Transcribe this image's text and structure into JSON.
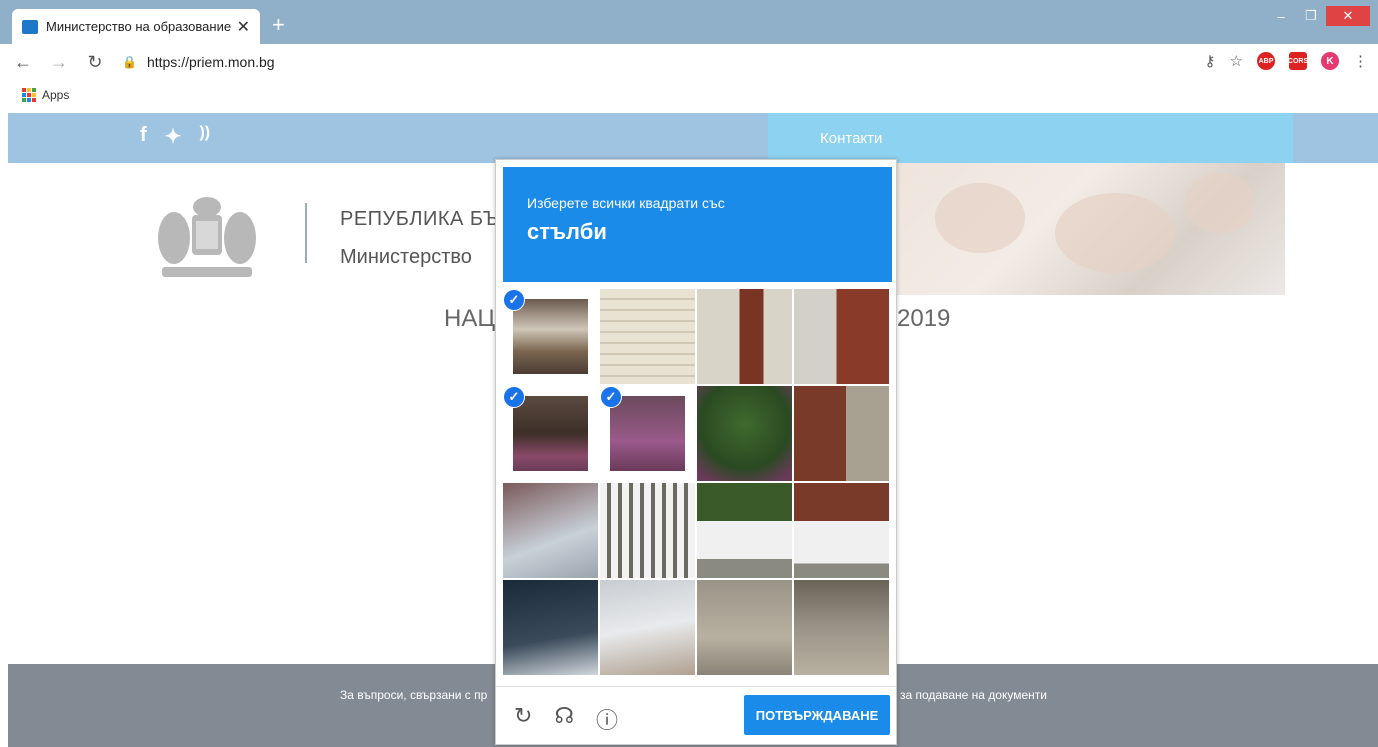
{
  "browser": {
    "tab_title": "Министерство на образованиет",
    "url": "https://priem.mon.bg",
    "bookmark_apps": "Apps",
    "extensions": {
      "abp": "ABP",
      "cors": "CORS",
      "profile": "K"
    }
  },
  "site": {
    "nav_contacts": "Контакти",
    "social": [
      "f",
      "🐦",
      "RSS"
    ],
    "republic_title": "РЕПУБЛИКА БЪ",
    "ministry_title": "Министерство",
    "national_left": "НАЦ",
    "national_right": "2019",
    "footer_left": "За въпроси, свързани с пр",
    "footer_right": "за подаване на документи"
  },
  "captcha": {
    "instruction": "Изберете всички квадрати със",
    "target_word": "стълби",
    "verify_label": "ПОТВЪРЖДАВАНЕ",
    "selected_tiles": [
      0,
      4,
      5
    ],
    "icons": [
      "reload-icon",
      "headphones-icon",
      "info-icon"
    ],
    "accent_color": "#1a8be8"
  }
}
